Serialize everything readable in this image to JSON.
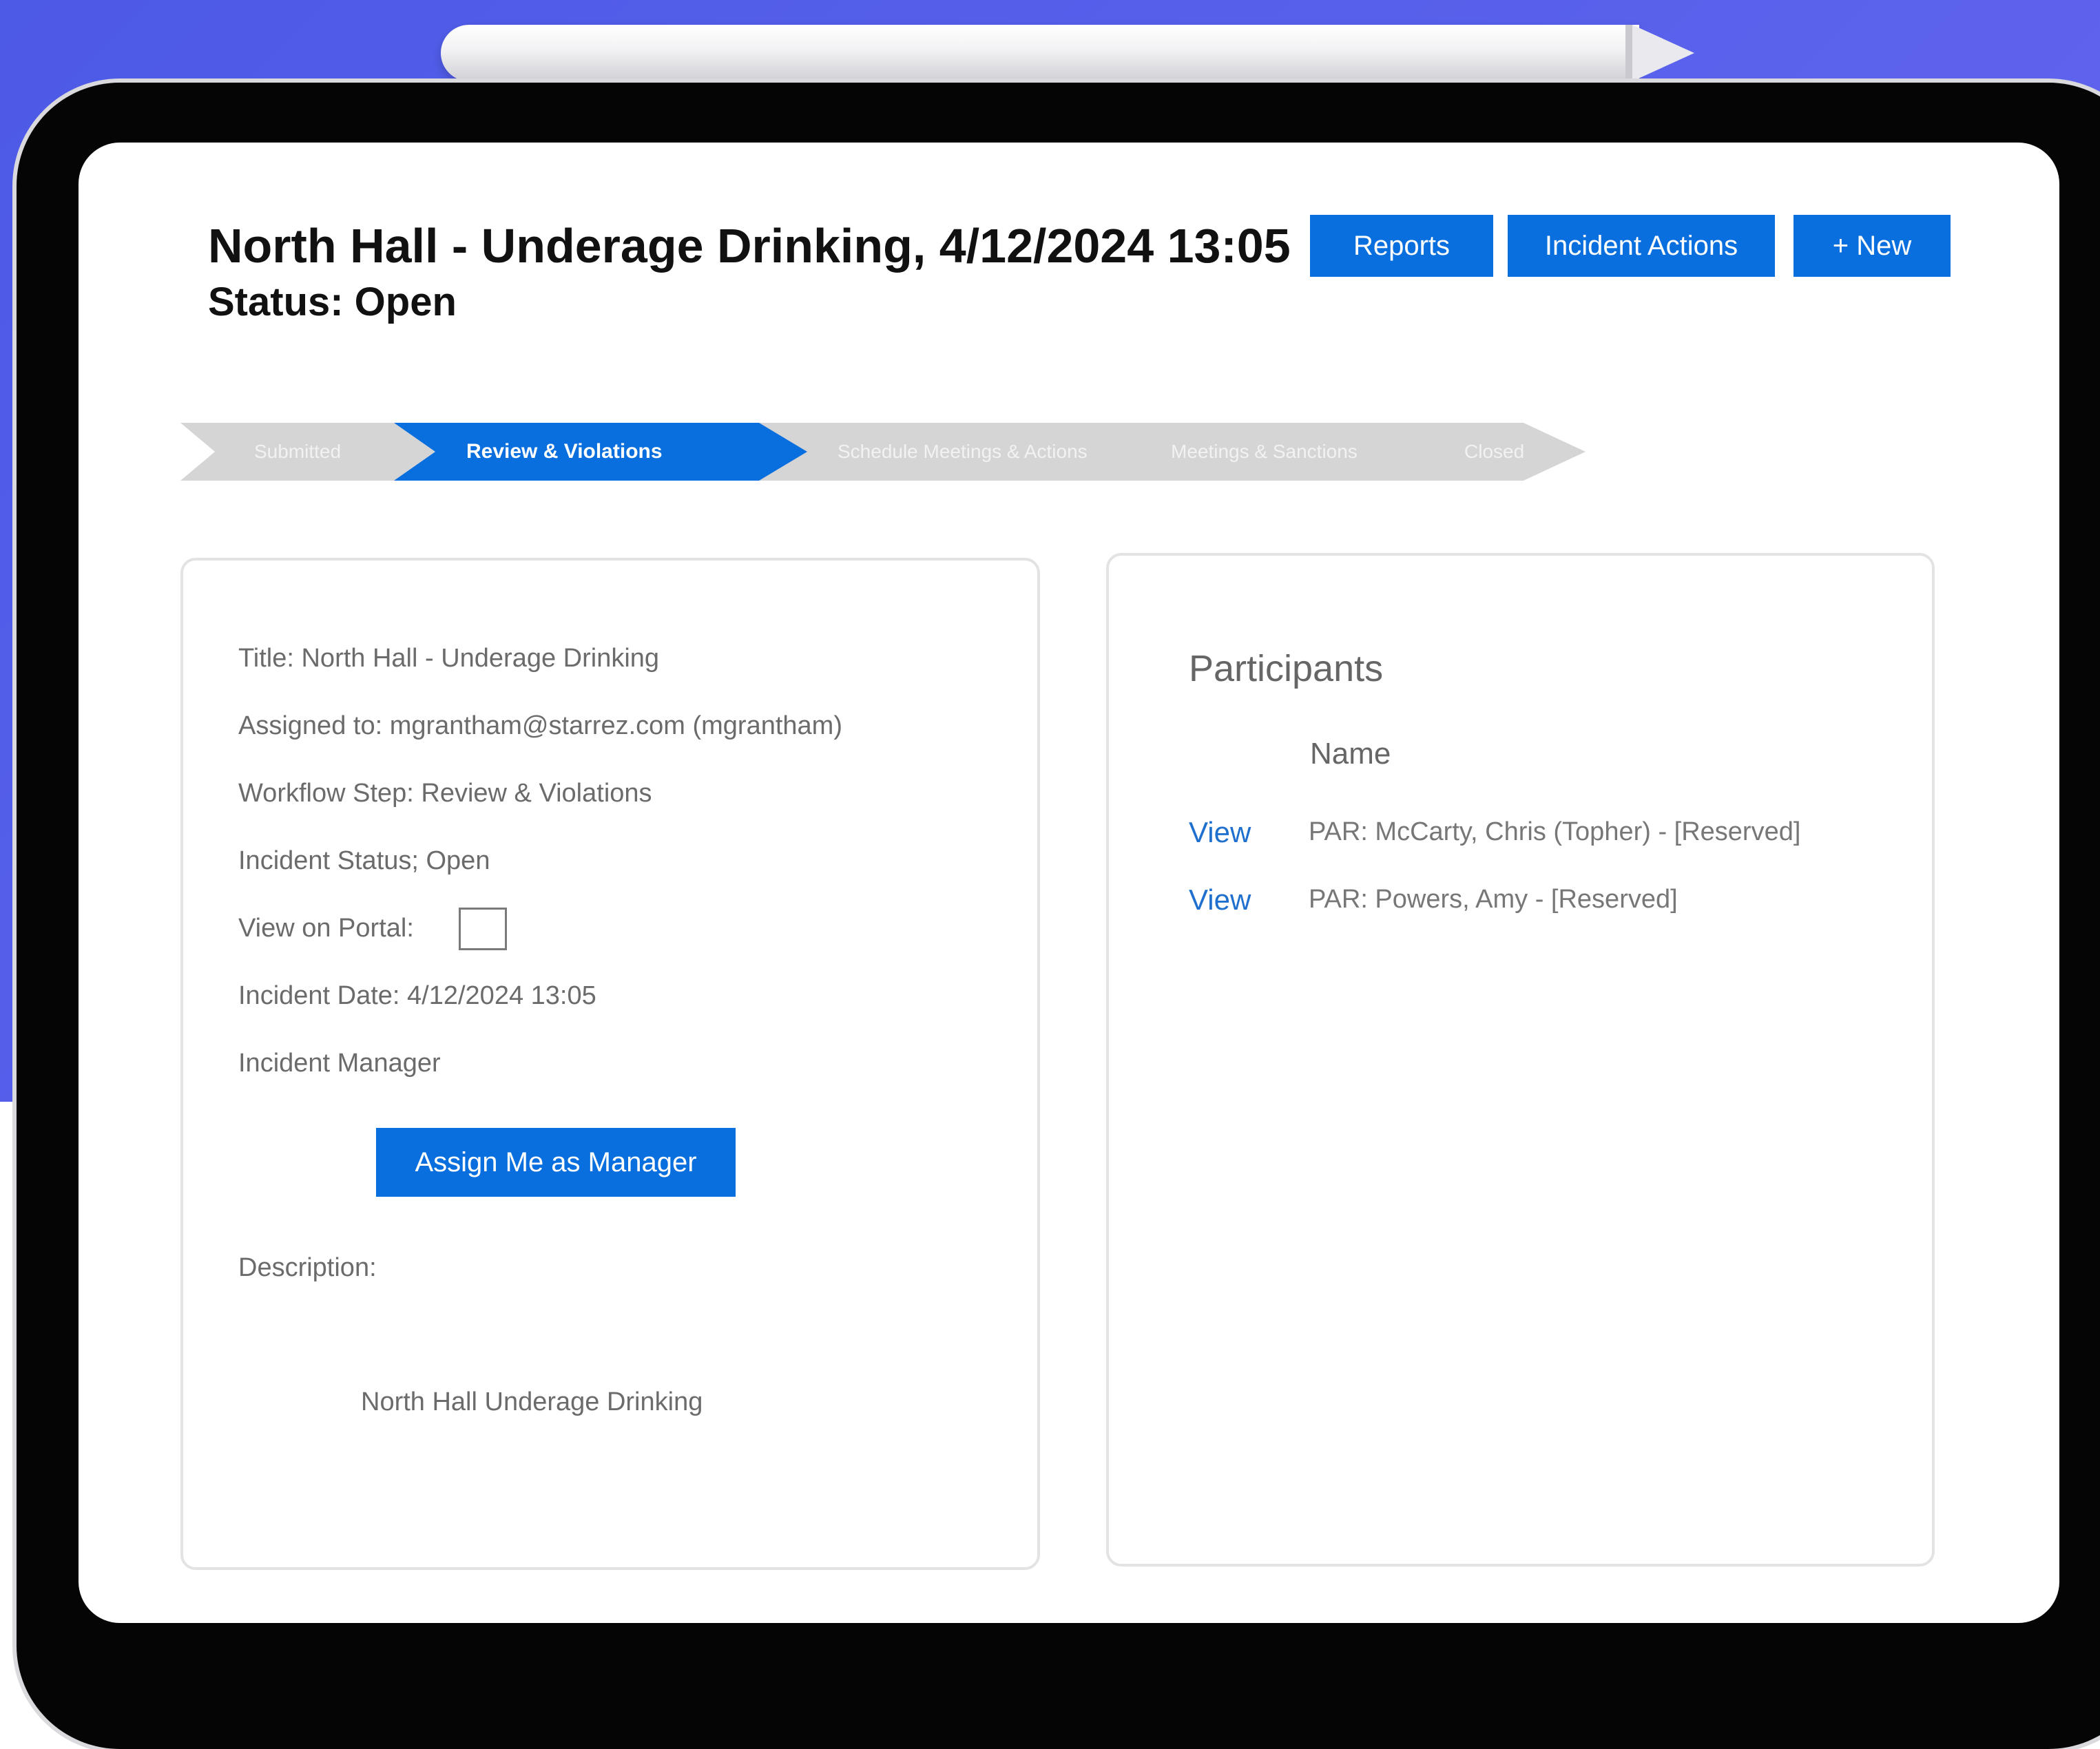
{
  "header": {
    "title": "North Hall - Underage Drinking, 4/12/2024 13:05",
    "status": "Status: Open"
  },
  "toolbar": {
    "reports_label": "Reports",
    "incident_actions_label": "Incident Actions",
    "new_label": "+ New"
  },
  "workflow": {
    "steps": [
      "Submitted",
      "Review & Violations",
      "Schedule Meetings & Actions",
      "Meetings & Sanctions",
      "Closed"
    ],
    "active_step": "Review & Violations",
    "active_color": "#0a6fde",
    "inactive_color": "#d5d5d5"
  },
  "details": {
    "title_line": "Title:  North Hall - Underage Drinking",
    "assigned_line": "Assigned to:  mgrantham@starrez.com (mgrantham)",
    "workflow_step_line": "Workflow Step: Review & Violations",
    "incident_status_line": "Incident Status; Open",
    "view_on_portal_label": "View on Portal:",
    "view_on_portal_checked": false,
    "incident_date_line": "Incident Date: 4/12/2024 13:05",
    "incident_manager_label": "Incident Manager",
    "assign_button_label": "Assign Me as Manager",
    "description_label": "Description:",
    "description_text": "North Hall Underage Drinking"
  },
  "participants": {
    "title": "Participants",
    "column_name": "Name",
    "rows": [
      {
        "link": "View",
        "name": "PAR: McCarty, Chris (Topher) - [Reserved]"
      },
      {
        "link": "View",
        "name": "PAR: Powers, Amy - [Reserved]"
      }
    ]
  },
  "colors": {
    "primary": "#0a6fde",
    "background": "#5860e8"
  }
}
